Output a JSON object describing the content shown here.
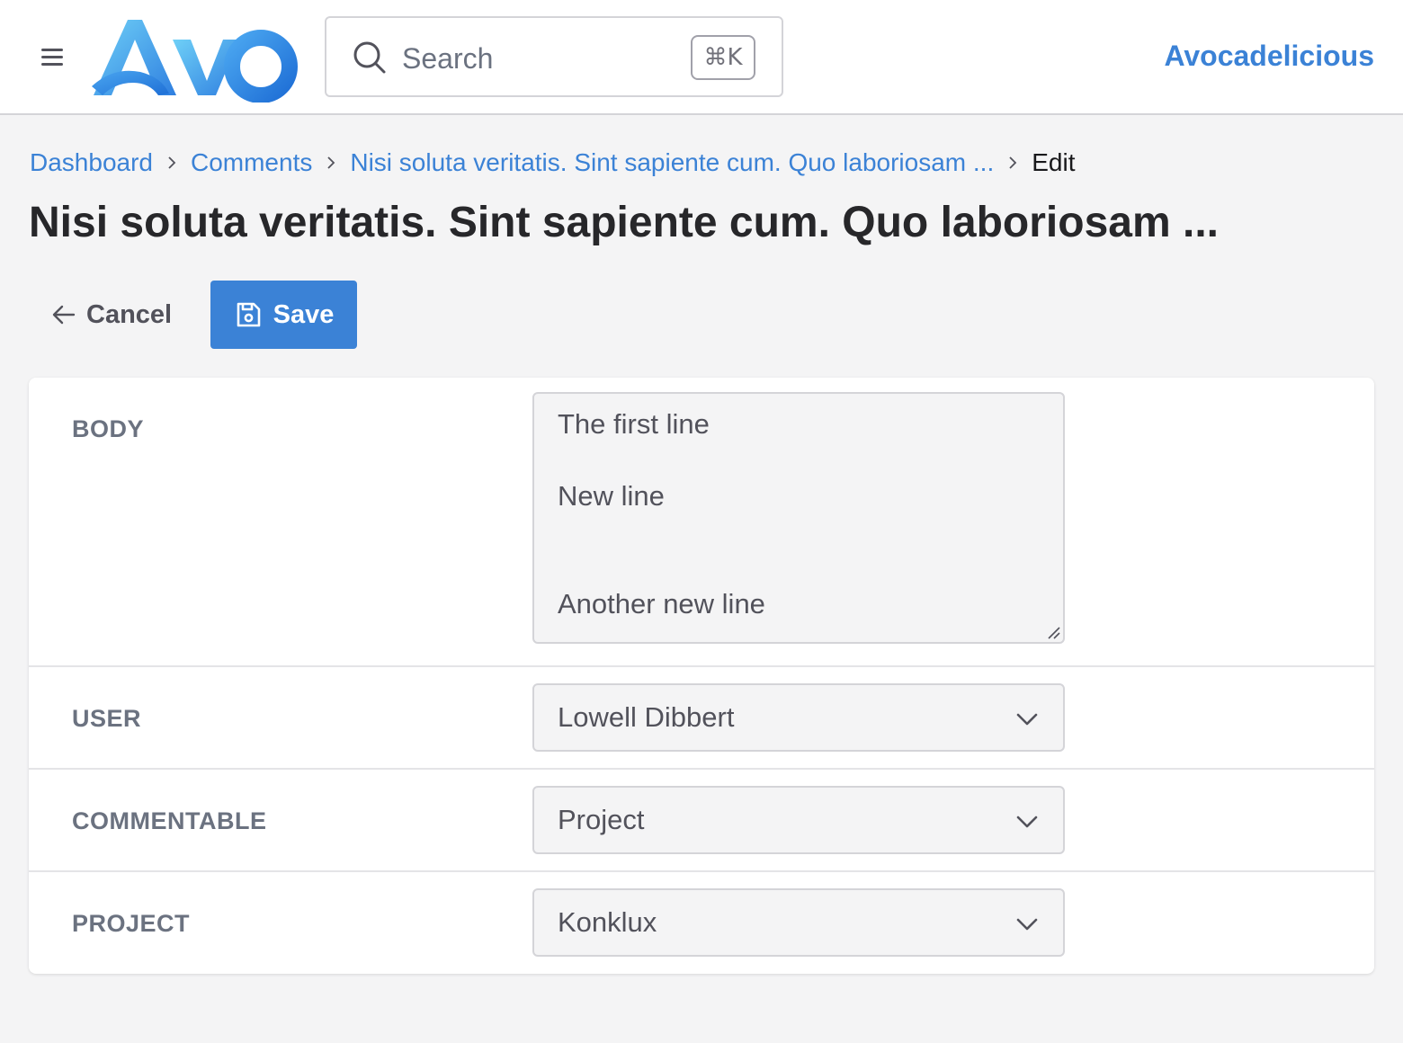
{
  "navbar": {
    "logo_text": "AVO",
    "search": {
      "placeholder": "Search",
      "shortcut": "⌘K"
    },
    "brand_link": "Avocadelicious",
    "accent_color": "#3b82d6"
  },
  "breadcrumb": [
    {
      "label": "Dashboard"
    },
    {
      "label": "Comments"
    },
    {
      "label": "Nisi soluta veritatis. Sint sapiente cum. Quo laboriosam ..."
    },
    {
      "label": "Edit"
    }
  ],
  "page_title": "Nisi soluta veritatis. Sint sapiente cum. Quo laboriosam ...",
  "actions": {
    "cancel_label": "Cancel",
    "save_label": "Save"
  },
  "fields": {
    "body": {
      "label": "BODY",
      "lines": [
        "The first line",
        "New line",
        "Another new line"
      ]
    },
    "user": {
      "label": "USER",
      "value": "Lowell Dibbert"
    },
    "commentable": {
      "label": "COMMENTABLE",
      "value": "Project"
    },
    "project": {
      "label": "PROJECT",
      "value": "Konklux"
    }
  },
  "icons": [
    "hamburger-icon",
    "search-icon",
    "chevron-right-icon",
    "arrow-left-icon",
    "save-icon",
    "chevron-down-icon",
    "resize-grip-icon"
  ]
}
